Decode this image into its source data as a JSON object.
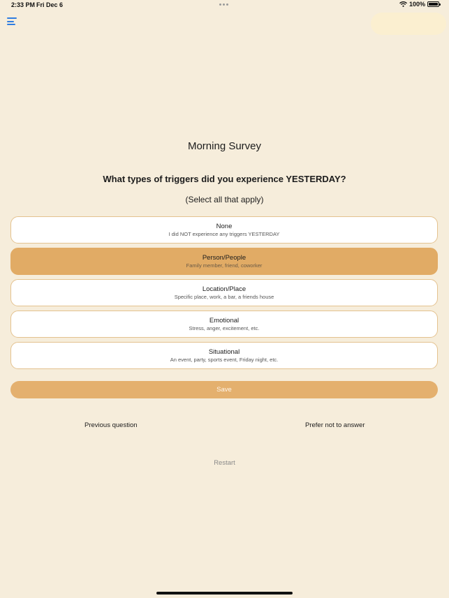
{
  "status_bar": {
    "time": "2:33 PM",
    "date": "Fri Dec 6",
    "battery": "100%",
    "battery_level": 1.0
  },
  "survey": {
    "title": "Morning Survey",
    "question": "What types of triggers did you experience YESTERDAY?",
    "instruction": "(Select all that apply)"
  },
  "options": [
    {
      "label": "None",
      "sub": "I did NOT experience any triggers YESTERDAY",
      "selected": false
    },
    {
      "label": "Person/People",
      "sub": "Family member, friend, coworker",
      "selected": true
    },
    {
      "label": "Location/Place",
      "sub": "Specific place, work, a bar, a friends house",
      "selected": false
    },
    {
      "label": "Emotional",
      "sub": "Stress, anger, excitement, etc.",
      "selected": false
    },
    {
      "label": "Situational",
      "sub": "An event, party, sports event, Friday night, etc.",
      "selected": false
    }
  ],
  "actions": {
    "save": "Save",
    "previous": "Previous question",
    "skip": "Prefer not to answer",
    "restart": "Restart"
  },
  "colors": {
    "background": "#f6eddb",
    "accent": "#e1ab65",
    "menu_icon": "#2f7de1"
  },
  "icons": {
    "menu": "hamburger-menu-icon",
    "wifi": "wifi-icon",
    "battery": "battery-icon"
  }
}
